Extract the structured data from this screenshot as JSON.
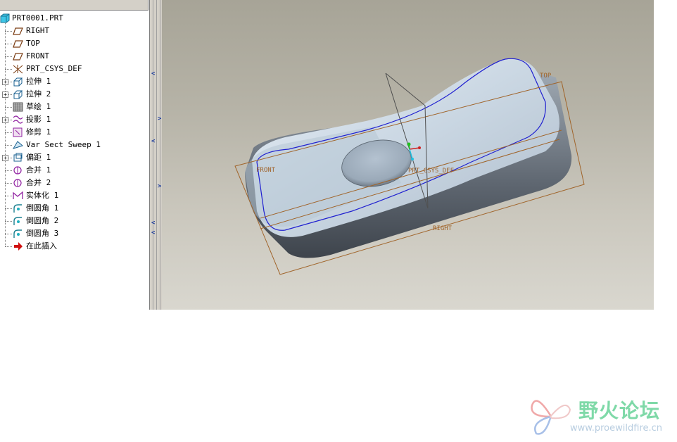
{
  "tree": {
    "root": "PRT0001.PRT",
    "items": [
      {
        "label": "RIGHT",
        "icon": "datum-plane-icon",
        "expandable": false
      },
      {
        "label": "TOP",
        "icon": "datum-plane-icon",
        "expandable": false
      },
      {
        "label": "FRONT",
        "icon": "datum-plane-icon",
        "expandable": false
      },
      {
        "label": "PRT_CSYS_DEF",
        "icon": "coordinate-system-icon",
        "expandable": false
      },
      {
        "label": "拉伸 1",
        "icon": "extrude-icon",
        "expandable": true
      },
      {
        "label": "拉伸 2",
        "icon": "extrude-icon",
        "expandable": true
      },
      {
        "label": "草绘 1",
        "icon": "sketch-icon",
        "expandable": false
      },
      {
        "label": "投影 1",
        "icon": "projection-icon",
        "expandable": true
      },
      {
        "label": "修剪 1",
        "icon": "trim-icon",
        "expandable": false
      },
      {
        "label": "Var Sect Sweep 1",
        "icon": "sweep-icon",
        "expandable": false
      },
      {
        "label": "偏距 1",
        "icon": "offset-icon",
        "expandable": true
      },
      {
        "label": "合并 1",
        "icon": "merge-icon",
        "expandable": false
      },
      {
        "label": "合并 2",
        "icon": "merge-icon",
        "expandable": false
      },
      {
        "label": "实体化 1",
        "icon": "solidify-icon",
        "expandable": false
      },
      {
        "label": "倒圆角 1",
        "icon": "round-icon",
        "expandable": false
      },
      {
        "label": "倒圆角 2",
        "icon": "round-icon",
        "expandable": false
      },
      {
        "label": "倒圆角 3",
        "icon": "round-icon",
        "expandable": false
      },
      {
        "label": "在此插入",
        "icon": "insert-here-arrow-icon",
        "expandable": false
      }
    ]
  },
  "viewport": {
    "datum_labels": {
      "top": "TOP",
      "front": "FRONT",
      "right": "RIGHT",
      "csys": "PRT_CSYS_DEF"
    },
    "datum_color": "#a0642a",
    "curve_color": "#2020d0"
  },
  "watermark": {
    "title": "野火论坛",
    "url": "www.proewildfire.cn"
  }
}
